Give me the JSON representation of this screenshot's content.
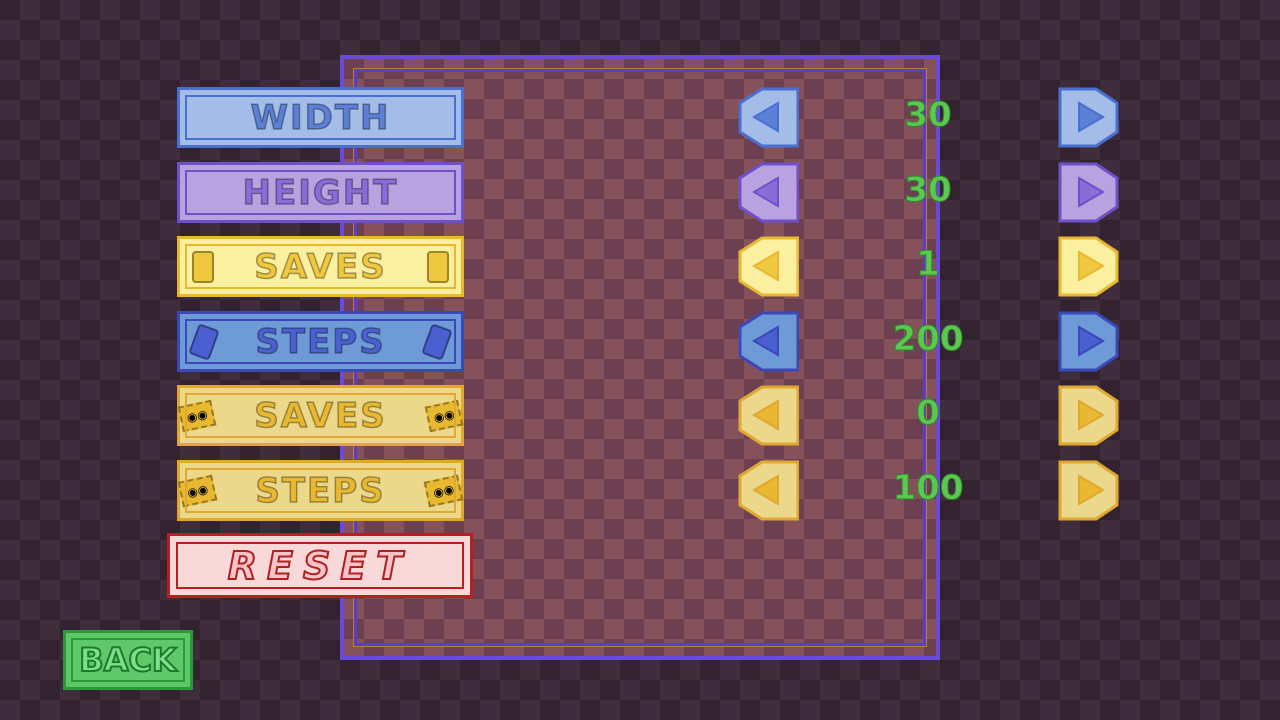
{
  "rows": [
    {
      "label": "WIDTH",
      "value": "30",
      "icon": "none",
      "fill": "#a3bde8",
      "border": "#4a6fd0",
      "text": "#5b80d6"
    },
    {
      "label": "HEIGHT",
      "value": "30",
      "icon": "none",
      "fill": "#b8a3e0",
      "border": "#7050c8",
      "text": "#8a6bd8"
    },
    {
      "label": "SAVES",
      "value": "1",
      "icon": "save-book-icon",
      "fill": "#fbf0a0",
      "border": "#e8b830",
      "text": "#f0c840"
    },
    {
      "label": "STEPS",
      "value": "200",
      "icon": "card-icon",
      "fill": "#6e9ad8",
      "border": "#3a48b8",
      "text": "#4a60d0"
    },
    {
      "label": "SAVES",
      "value": "0",
      "icon": "ticket-icon",
      "fill": "#ecd88a",
      "border": "#e0a830",
      "text": "#e8b830"
    },
    {
      "label": "STEPS",
      "value": "100",
      "icon": "ticket-icon",
      "fill": "#ecd88a",
      "border": "#e0a830",
      "text": "#e8b830"
    }
  ],
  "reset_label": "RESET",
  "back_label": "BACK",
  "value_color": "#5cc850"
}
